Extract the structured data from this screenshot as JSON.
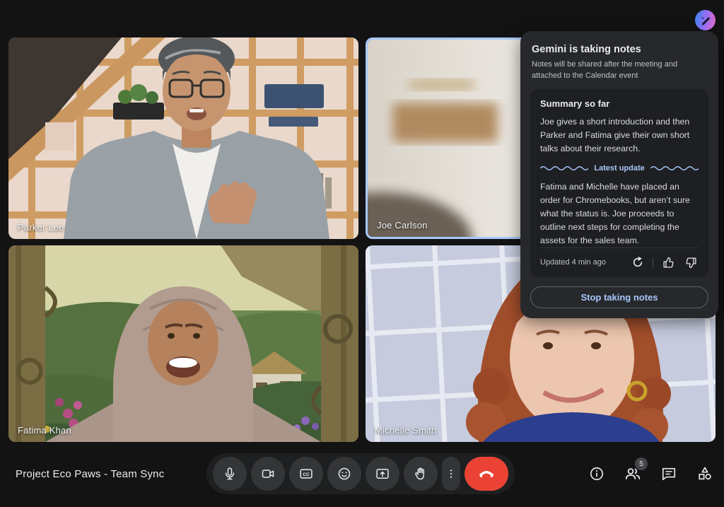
{
  "meeting": {
    "title": "Project Eco Paws - Team Sync"
  },
  "participants": [
    {
      "name": "Parker Lee",
      "active": false
    },
    {
      "name": "Joe Carlson",
      "active": true
    },
    {
      "name": "Fatima Khan",
      "active": false
    },
    {
      "name": "Michelle Smith",
      "active": false
    }
  ],
  "gemini_fab": {
    "icon": "gemini-pen-spark-icon"
  },
  "gemini_panel": {
    "title": "Gemini is taking notes",
    "subtitle": "Notes will be shared after the meeting and attached to the Calendar event",
    "summary_title": "Summary so far",
    "summary_text": "Joe gives a short introduction and then Parker and Fatima give their own short talks about their research.",
    "latest_update_label": "Latest update",
    "latest_update_text": "Fatima and Michelle have placed an order for Chromebooks, but aren’t sure what the status is. Joe proceeds to outline next steps for completing the assets for the sales team.",
    "updated_label": "Updated 4 min ago",
    "footer_icons": [
      "refresh-icon",
      "thumb-up-icon",
      "thumb-down-icon"
    ],
    "stop_button_label": "Stop taking notes"
  },
  "toolbar": {
    "buttons": [
      {
        "id": "mic",
        "icon": "mic-icon"
      },
      {
        "id": "camera",
        "icon": "videocam-icon"
      },
      {
        "id": "captions",
        "icon": "captions-icon"
      },
      {
        "id": "reactions",
        "icon": "emoji-icon"
      },
      {
        "id": "present",
        "icon": "present-screen-icon"
      },
      {
        "id": "raise-hand",
        "icon": "raise-hand-icon"
      },
      {
        "id": "more",
        "icon": "more-vert-icon"
      },
      {
        "id": "end-call",
        "icon": "end-call-icon"
      }
    ]
  },
  "right_controls": [
    {
      "id": "info",
      "icon": "info-icon"
    },
    {
      "id": "people",
      "icon": "people-icon",
      "badge": "5"
    },
    {
      "id": "chat",
      "icon": "chat-icon"
    },
    {
      "id": "activities",
      "icon": "activities-icon"
    }
  ],
  "colors": {
    "accent_blue": "#a8c7fa",
    "active_speaker_border": "#a8c7fa",
    "end_call_red": "#ea4335",
    "gemini_gradient": [
      "#4a80f0",
      "#9a6df2",
      "#e06cc8"
    ],
    "background": "#131314"
  }
}
